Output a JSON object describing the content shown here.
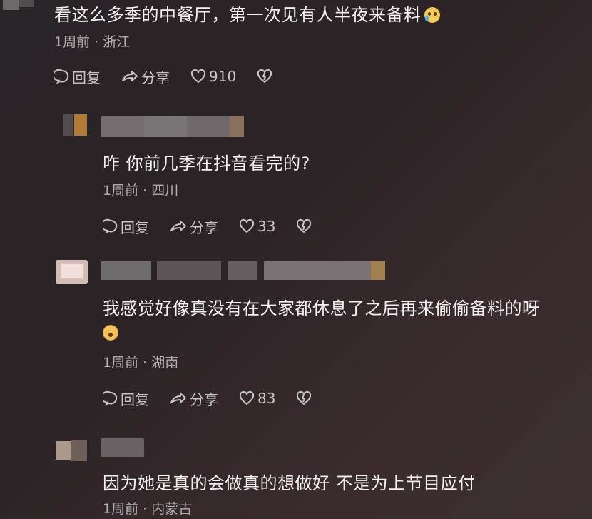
{
  "comments": [
    {
      "text": "看这么多季的中餐厅，第一次见有人半夜来备料",
      "emoji": "loudly-crying-face",
      "meta": "1周前 · 浙江",
      "reply": "回复",
      "share": "分享",
      "likes": "910"
    },
    {
      "text": "咋 你前几季在抖音看完的?",
      "meta": "1周前 · 四川",
      "reply": "回复",
      "share": "分享",
      "likes": "33"
    },
    {
      "text": "我感觉好像真没有在大家都休息了之后再来偷偷备料的呀",
      "emoji": "astonished-face",
      "meta": "1周前 · 湖南",
      "reply": "回复",
      "share": "分享",
      "likes": "83"
    },
    {
      "text": "因为她是真的会做真的想做好 不是为上节目应付",
      "meta": "1周前 · 内蒙古"
    }
  ],
  "colors": {
    "background": "#2b2326",
    "text": "#f4f1f2",
    "meta": "#b3aeb0",
    "actions": "#c9c4c6"
  }
}
